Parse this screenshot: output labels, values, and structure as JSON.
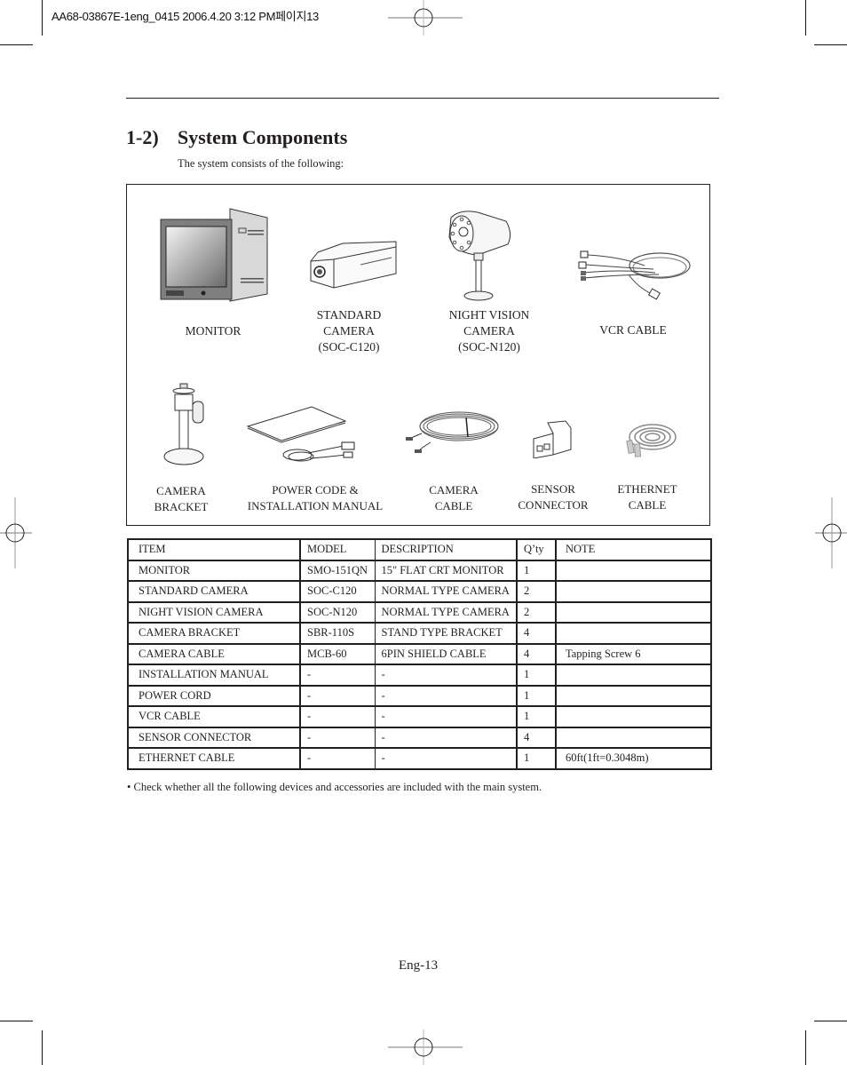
{
  "print_slug": "AA68-03867E-1eng_0415  2006.4.20 3:12 PM페이지13",
  "section": {
    "number": "1-2)",
    "title": "System Components",
    "intro": "The system consists of the following:"
  },
  "components": [
    {
      "icon": "monitor-image",
      "label_lines": [
        "MONITOR"
      ]
    },
    {
      "icon": "standard-camera-image",
      "label_lines": [
        "STANDARD",
        "CAMERA",
        "(SOC-C120)"
      ]
    },
    {
      "icon": "night-vision-camera-image",
      "label_lines": [
        "NIGHT VISION",
        "CAMERA",
        "(SOC-N120)"
      ]
    },
    {
      "icon": "vcr-cable-image",
      "label_lines": [
        "VCR CABLE"
      ]
    },
    {
      "icon": "camera-bracket-image",
      "label_lines": [
        "CAMERA",
        "BRACKET"
      ]
    },
    {
      "icon": "power-cord-manual-image",
      "label_lines": [
        "POWER CODE &",
        "INSTALLATION MANUAL"
      ]
    },
    {
      "icon": "camera-cable-image",
      "label_lines": [
        "CAMERA",
        "CABLE"
      ]
    },
    {
      "icon": "sensor-connector-image",
      "label_lines": [
        "SENSOR",
        "CONNECTOR"
      ]
    },
    {
      "icon": "ethernet-cable-image",
      "label_lines": [
        "ETHERNET",
        "CABLE"
      ]
    }
  ],
  "table": {
    "headers": [
      "ITEM",
      "MODEL",
      "DESCRIPTION",
      "Q’ty",
      "NOTE"
    ],
    "rows": [
      [
        "MONITOR",
        "SMO-151QN",
        "15\" FLAT CRT MONITOR",
        "1",
        ""
      ],
      [
        "STANDARD CAMERA",
        "SOC-C120",
        "NORMAL TYPE CAMERA",
        "2",
        ""
      ],
      [
        "NIGHT VISION CAMERA",
        "SOC-N120",
        "NORMAL TYPE CAMERA",
        "2",
        ""
      ],
      [
        "CAMERA BRACKET",
        "SBR-110S",
        "STAND TYPE BRACKET",
        "4",
        ""
      ],
      [
        "CAMERA CABLE",
        "MCB-60",
        "6PIN SHIELD CABLE",
        "4",
        "Tapping Screw 6"
      ],
      [
        "INSTALLATION MANUAL",
        "-",
        "-",
        "1",
        ""
      ],
      [
        "POWER CORD",
        "-",
        "-",
        "1",
        ""
      ],
      [
        "VCR CABLE",
        "-",
        "-",
        "1",
        ""
      ],
      [
        "SENSOR CONNECTOR",
        "-",
        "-",
        "4",
        ""
      ],
      [
        "ETHERNET CABLE",
        "-",
        "-",
        "1",
        "60ft(1ft=0.3048m)"
      ]
    ]
  },
  "footnote": "• Check whether all the following devices and accessories are included with the main system.",
  "page_number": "Eng-13"
}
